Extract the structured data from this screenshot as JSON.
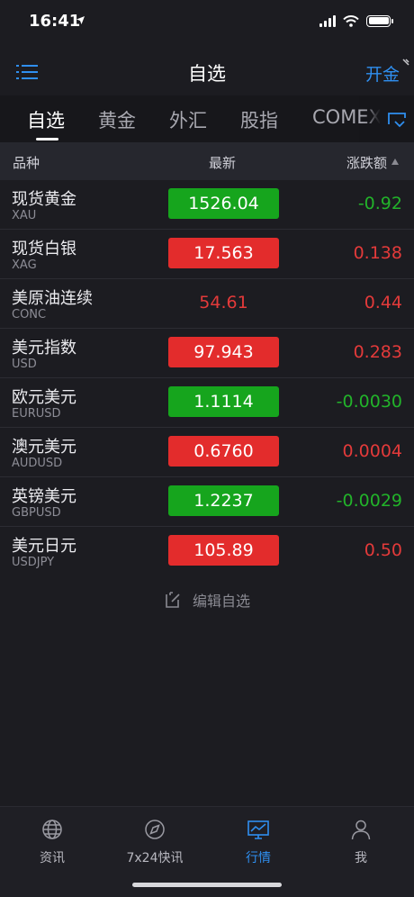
{
  "status_bar": {
    "time": "16:41"
  },
  "nav": {
    "title": "自选",
    "right_label": "开金"
  },
  "tabs": [
    {
      "label": "自选",
      "active": true
    },
    {
      "label": "黄金",
      "active": false
    },
    {
      "label": "外汇",
      "active": false
    },
    {
      "label": "股指",
      "active": false
    },
    {
      "label": "COMEX",
      "active": false
    }
  ],
  "header": {
    "name": "品种",
    "latest": "最新",
    "change": "涨跌额"
  },
  "rows": [
    {
      "name": "现货黄金",
      "code": "XAU",
      "price": "1526.04",
      "change": "-0.92",
      "trend": "down"
    },
    {
      "name": "现货白银",
      "code": "XAG",
      "price": "17.563",
      "change": "0.138",
      "trend": "up"
    },
    {
      "name": "美原油连续",
      "code": "CONC",
      "price": "54.61",
      "change": "0.44",
      "trend": "flat"
    },
    {
      "name": "美元指数",
      "code": "USD",
      "price": "97.943",
      "change": "0.283",
      "trend": "up"
    },
    {
      "name": "欧元美元",
      "code": "EURUSD",
      "price": "1.1114",
      "change": "-0.0030",
      "trend": "down"
    },
    {
      "name": "澳元美元",
      "code": "AUDUSD",
      "price": "0.6760",
      "change": "0.0004",
      "trend": "up"
    },
    {
      "name": "英镑美元",
      "code": "GBPUSD",
      "price": "1.2237",
      "change": "-0.0029",
      "trend": "down"
    },
    {
      "name": "美元日元",
      "code": "USDJPY",
      "price": "105.89",
      "change": "0.50",
      "trend": "up"
    }
  ],
  "edit_watch": {
    "label": "编辑自选"
  },
  "tab_bar": [
    {
      "label": "资讯",
      "icon": "globe-icon",
      "active": false
    },
    {
      "label": "7x24快讯",
      "icon": "compass-icon",
      "active": false
    },
    {
      "label": "行情",
      "icon": "chart-icon",
      "active": true
    },
    {
      "label": "我",
      "icon": "person-icon",
      "active": false
    }
  ],
  "colors": {
    "accent": "#2f8ff0",
    "up": "#e32c2c",
    "down": "#16a51d",
    "background": "#1c1c21"
  }
}
